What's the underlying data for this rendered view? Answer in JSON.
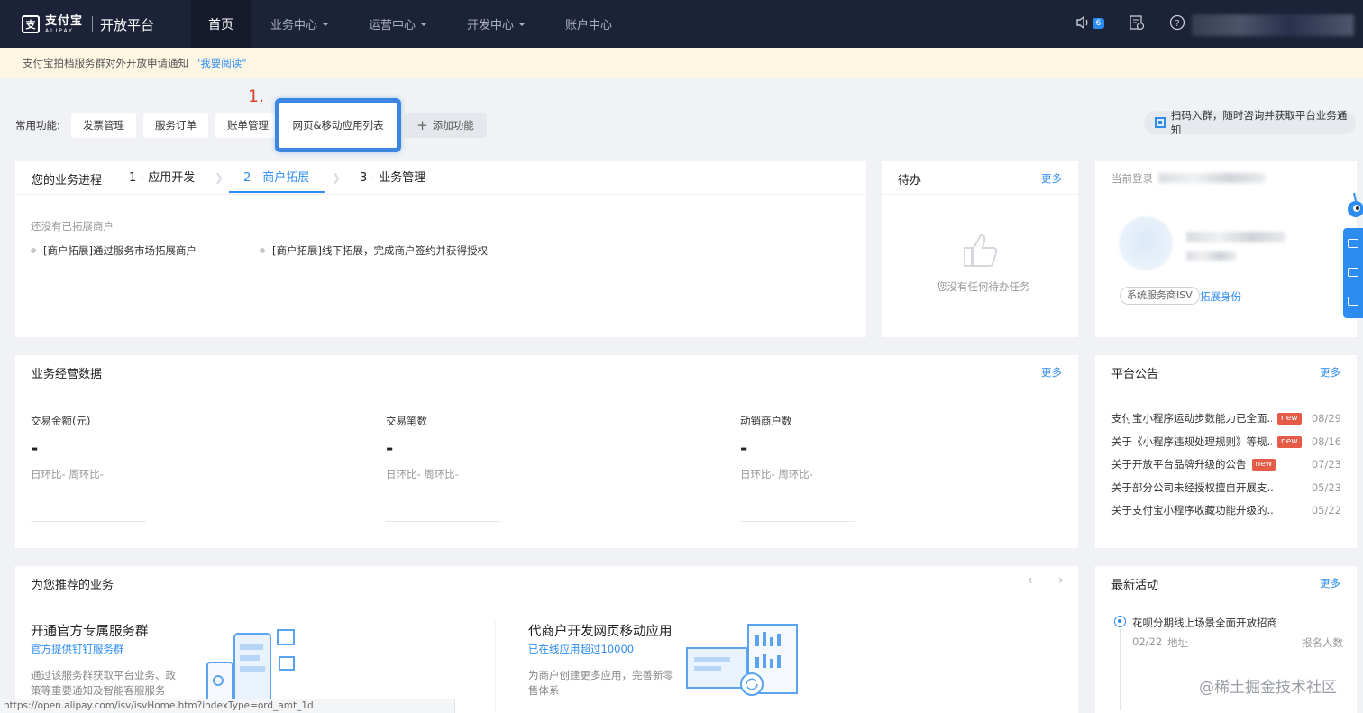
{
  "nav": {
    "logo_cn": "支付宝",
    "logo_en": "ALIPAY",
    "logo_mark": "支",
    "platform_title": "开放平台",
    "home": "首页",
    "items": [
      {
        "label": "业务中心"
      },
      {
        "label": "运营中心"
      },
      {
        "label": "开发中心"
      },
      {
        "label": "账户中心"
      }
    ],
    "notification_count": "6"
  },
  "notice": {
    "text": "支付宝拍档服务群对外开放申请通知",
    "link": "\"我要阅读\""
  },
  "shortcuts": {
    "label": "常用功能:",
    "buttons": [
      "发票管理",
      "服务订单",
      "账单管理"
    ],
    "highlighted": "网页&移动应用列表",
    "step_marker": "1.",
    "add_label": "添加功能",
    "qr_text": "扫码入群，随时咨询并获取平台业务通知"
  },
  "progress": {
    "title": "您的业务进程",
    "tabs": [
      "1 - 应用开发",
      "2 - 商户拓展",
      "3 - 业务管理"
    ],
    "active_tab": 1,
    "empty_text": "还没有已拓展商户",
    "bullets": [
      "[商户拓展]通过服务市场拓展商户",
      "[商户拓展]线下拓展，完成商户签约并获得授权"
    ]
  },
  "todo": {
    "title": "待办",
    "more": "更多",
    "empty_text": "您没有任何待办任务"
  },
  "account": {
    "login_label": "当前登录",
    "role_tag": "系统服务商ISV",
    "expand_link": "拓展身份"
  },
  "biz_data": {
    "title": "业务经营数据",
    "more": "更多",
    "metrics": [
      {
        "label": "交易金额(元)",
        "value": "-",
        "sub": "日环比-   周环比-"
      },
      {
        "label": "交易笔数",
        "value": "-",
        "sub": "日环比-   周环比-"
      },
      {
        "label": "动销商户数",
        "value": "-",
        "sub": "日环比-   周环比-"
      }
    ]
  },
  "announcements": {
    "title": "平台公告",
    "more": "更多",
    "new_label": "new",
    "items": [
      {
        "text": "支付宝小程序运动步数能力已全面...",
        "is_new": true,
        "date": "08/29"
      },
      {
        "text": "关于《小程序违规处理规则》等规...",
        "is_new": true,
        "date": "08/16"
      },
      {
        "text": "关于开放平台品牌升级的公告",
        "is_new": true,
        "date": "07/23"
      },
      {
        "text": "关于部分公司未经授权擅自开展支...",
        "is_new": false,
        "date": "05/23"
      },
      {
        "text": "关于支付宝小程序收藏功能升级的...",
        "is_new": false,
        "date": "05/22"
      }
    ]
  },
  "recommended": {
    "title": "为您推荐的业务",
    "items": [
      {
        "title": "开通官方专属服务群",
        "sub": "官方提供钉钉服务群",
        "desc": "通过该服务群获取平台业务、政策等重要通知及智能客服服务"
      },
      {
        "title": "代商户开发网页移动应用",
        "sub": "已在线应用超过10000",
        "desc": "为商户创建更多应用，完善新零售体系"
      }
    ]
  },
  "activity": {
    "title": "最新活动",
    "more": "更多",
    "items": [
      {
        "title": "花呗分期线上场景全面开放招商",
        "date": "02/22",
        "location": "地址",
        "count_label": "报名人数"
      }
    ]
  },
  "status_url": "https://open.alipay.com/isv/isvHome.htm?indexType=ord_amt_1d",
  "watermark": "@稀土掘金技术社区",
  "colors": {
    "nav_bg": "#1c2237",
    "accent": "#2d8cf0",
    "new_badge": "#e45b47",
    "highlight_border": "#3a86e0"
  },
  "icons": [
    "speaker-icon",
    "calendar-icon",
    "help-icon",
    "thumbs-up-icon",
    "qr-code-icon",
    "plus-icon",
    "robot-mascot-icon"
  ]
}
